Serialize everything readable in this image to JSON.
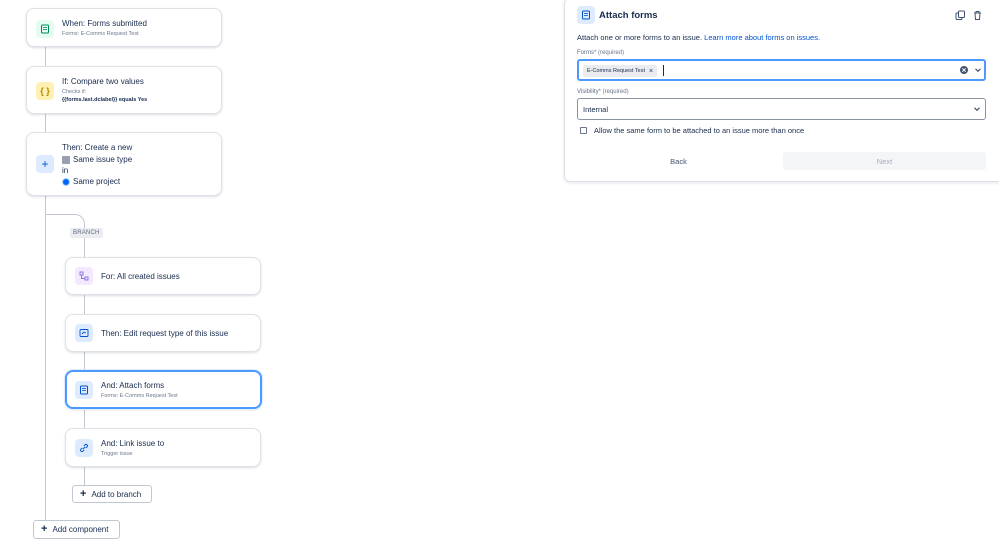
{
  "flow": {
    "trigger": {
      "title": "When: Forms submitted",
      "subtitle": "Forms: E-Comms Request Test",
      "icon": "form-icon"
    },
    "condition": {
      "title": "If: Compare two values",
      "line1": "Checks if:",
      "line2": "{{forms.last.dclabel}} equals Yes",
      "icon": "braces-icon"
    },
    "create": {
      "title": "Then: Create a new",
      "line1": "Same issue type",
      "line2": "in",
      "line3": "Same project",
      "icon": "plus-icon"
    },
    "branch_label": "BRANCH",
    "branch_items": [
      {
        "title": "For: All created issues",
        "subtitle": "",
        "icon": "branch-icon"
      },
      {
        "title": "Then: Edit request type of this issue",
        "subtitle": "",
        "icon": "edit-request-icon"
      },
      {
        "title": "And: Attach forms",
        "subtitle": "Forms: E-Comms Request Test",
        "icon": "form-icon"
      },
      {
        "title": "And: Link issue to",
        "subtitle": "Trigger issue",
        "icon": "link-icon"
      }
    ],
    "add_to_branch": "Add to branch",
    "add_component": "Add component"
  },
  "panel": {
    "title": "Attach forms",
    "description": "Attach one or more forms to an issue.",
    "learn_more": "Learn more about forms on issues.",
    "forms_label": "Forms",
    "forms_required": "* (required)",
    "forms_value": "E-Comms Request Test",
    "visibility_label": "Visibility",
    "visibility_required": "* (required)",
    "visibility_value": "Internal",
    "checkbox_label": "Allow the same form to be attached to an issue more than once",
    "back_label": "Back",
    "next_label": "Next"
  },
  "colors": {
    "accent": "#0052cc",
    "focus": "#4c9aff",
    "trigger_bg": "#e3fcef",
    "condition_bg": "#fff0b3",
    "action_bg": "#deebff",
    "branch_bg": "#f3e8ff"
  }
}
